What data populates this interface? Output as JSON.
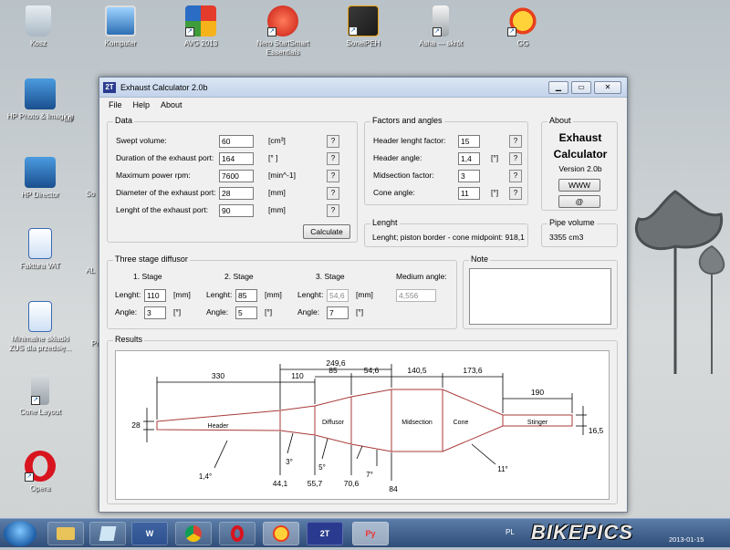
{
  "desktop": {
    "icons": [
      {
        "label": "Kosz"
      },
      {
        "label": "Komputer"
      },
      {
        "label": "AVG 2013"
      },
      {
        "label": "Nero StartSmart Essentials"
      },
      {
        "label": "SonelPEH"
      },
      {
        "label": "Asha --- skrót"
      },
      {
        "label": "GG"
      },
      {
        "label": "HP Photo & Imaging"
      },
      {
        "label": "HP Director"
      },
      {
        "label": "Faktura VAT"
      },
      {
        "label": "Minimalne składki ZUS dla przedsię..."
      },
      {
        "label": "Cone Layout"
      },
      {
        "label": "Opera"
      }
    ],
    "partial_labels": [
      "MI",
      "So",
      "AL",
      "Pr"
    ]
  },
  "window": {
    "title": "Exhaust Calculator 2.0b",
    "app_icon": "2T",
    "menu": [
      "File",
      "Help",
      "About"
    ]
  },
  "data_group": {
    "title": "Data",
    "rows": [
      {
        "label": "Swept volume:",
        "value": "60",
        "unit": "[cm³]"
      },
      {
        "label": "Duration of the exhaust port:",
        "value": "164",
        "unit": "[° ]"
      },
      {
        "label": "Maximum power rpm:",
        "value": "7600",
        "unit": "[min^-1]"
      },
      {
        "label": "Diameter of the exhaust port:",
        "value": "28",
        "unit": "[mm]"
      },
      {
        "label": "Lenght of the exhaust port:",
        "value": "90",
        "unit": "[mm]"
      }
    ],
    "help": "?",
    "calculate": "Calculate"
  },
  "factors_group": {
    "title": "Factors and angles",
    "rows": [
      {
        "label": "Header lenght factor:",
        "value": "15",
        "unit": ""
      },
      {
        "label": "Header angle:",
        "value": "1,4",
        "unit": "[°]"
      },
      {
        "label": "Midsection factor:",
        "value": "3",
        "unit": ""
      },
      {
        "label": "Cone angle:",
        "value": "11",
        "unit": "[°]"
      }
    ]
  },
  "about_group": {
    "title": "About",
    "line1": "Exhaust",
    "line2": "Calculator",
    "version": "Version 2.0b",
    "www": "WWW",
    "mail": "@"
  },
  "lenght_group": {
    "title": "Lenght",
    "text": "Lenght; piston border - cone midpoint:  918,1"
  },
  "pipe_group": {
    "title": "Pipe volume",
    "value": "3355 cm3"
  },
  "diffusor_group": {
    "title": "Three stage diffusor",
    "stages": [
      {
        "header": "1. Stage",
        "lenght_label": "Lenght:",
        "lenght": "110",
        "angle_label": "Angle:",
        "angle": "3"
      },
      {
        "header": "2. Stage",
        "lenght_label": "Lenght:",
        "lenght": "85",
        "angle_label": "Angle:",
        "angle": "5"
      },
      {
        "header": "3. Stage",
        "lenght_label": "Lenght:",
        "lenght": "54,6",
        "angle_label": "Angle:",
        "angle": "7"
      }
    ],
    "mm": "[mm]",
    "deg": "[°]",
    "medium_label": "Medium angle:",
    "medium_value": "4,556"
  },
  "note_group": {
    "title": "Note"
  },
  "results": {
    "title": "Results",
    "dims": {
      "header_len": "330",
      "stage1": "110",
      "stage2": "85",
      "stage3": "54,6",
      "diffusor_total": "249,6",
      "midsection": "140,5",
      "cone": "173,6",
      "stinger": "190",
      "inlet_d": "28",
      "outlet_d": "16,5"
    },
    "sections": {
      "header": "Header",
      "diffusor": "Diffusor",
      "midsection": "Midsection",
      "cone": "Cone",
      "stinger": "Stinger"
    },
    "angles": {
      "header": "1,4°",
      "stage1": "3°",
      "stage2": "5°",
      "stage3": "7°",
      "cone": "11°"
    },
    "diameters": {
      "d1": "44,1",
      "d2": "55,7",
      "d3": "70,6",
      "d4": "84"
    }
  },
  "taskbar": {
    "items": [
      "W",
      "2T",
      "Py"
    ],
    "lang": "PL",
    "logo": "BIKEPICS",
    "date": "2013-01-15"
  }
}
